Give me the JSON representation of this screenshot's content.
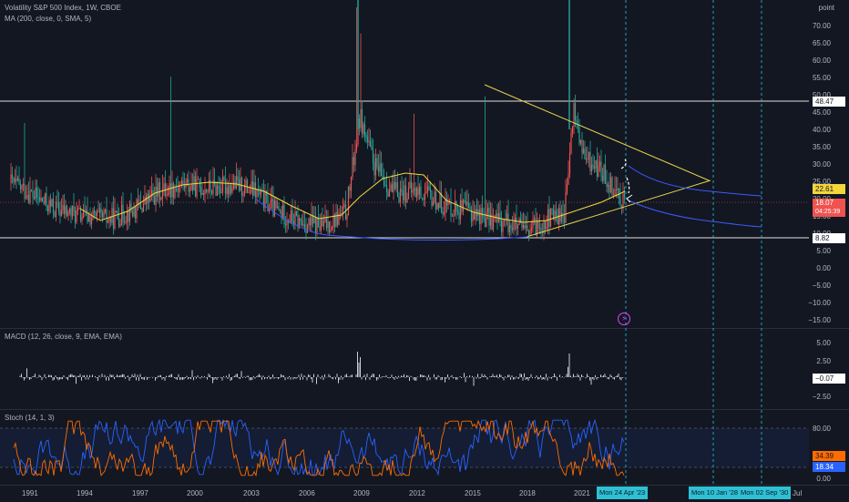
{
  "chart": {
    "title": "Volatility S&P 500 Index, 1W, CBOE",
    "ma_legend": "MA (200, close, 0, SMA, 5)",
    "price_unit": "point",
    "price_ticks": [
      "70.00",
      "65.00",
      "60.00",
      "55.00",
      "50.00",
      "45.00",
      "40.00",
      "35.00",
      "30.00",
      "25.00",
      "20.00",
      "15.00",
      "10.00",
      "5.00",
      "0.00",
      "−5.00",
      "−10.00",
      "−15.00"
    ],
    "level_upper": "48.47",
    "level_lower": "8.82",
    "ma_value": "22.61",
    "last_price": "18.07",
    "countdown": "04:25:39"
  },
  "macd": {
    "legend": "MACD (12, 26, close, 9, EMA, EMA)",
    "ticks": [
      "5.00",
      "2.50",
      "−2.50"
    ],
    "value": "−0.07"
  },
  "stoch": {
    "legend": "Stoch (14, 1, 3)",
    "ticks": [
      "80.00",
      "0.00"
    ],
    "k_value": "34.39",
    "d_value": "18.34"
  },
  "time_axis": {
    "years": [
      "1991",
      "1994",
      "1997",
      "2000",
      "2003",
      "2006",
      "2009",
      "2012",
      "2015",
      "2018",
      "2021"
    ],
    "highlights": [
      "Mon 24 Apr '23",
      "Mon 10 Jan '28",
      "Mon 02 Sep '30"
    ],
    "end_label": "Jul"
  },
  "colors": {
    "up": "#26a69a",
    "down": "#ef5350",
    "ma": "#f5d63b",
    "trend": "#e8d44d",
    "curve": "#3d5afe",
    "k": "#2962ff",
    "d": "#ff6d00",
    "vline": "#26c6da"
  },
  "icons": [
    "lightning-icon"
  ]
}
